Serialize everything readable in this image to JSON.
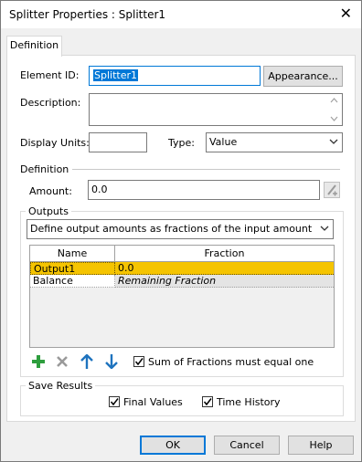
{
  "window": {
    "title": "Splitter Properties : Splitter1"
  },
  "tabs": [
    {
      "label": "Definition"
    }
  ],
  "form": {
    "element_id_label": "Element ID:",
    "element_id_value": "Splitter1",
    "appearance_label": "Appearance...",
    "description_label": "Description:",
    "description_value": "",
    "display_units_label": "Display Units:",
    "display_units_value": "",
    "type_label": "Type:",
    "type_value": "Value"
  },
  "definition": {
    "section_label": "Definition",
    "amount_label": "Amount:",
    "amount_value": "0.0"
  },
  "outputs": {
    "group_label": "Outputs",
    "mode_value": "Define output amounts as fractions of the input amount",
    "columns": {
      "name": "Name",
      "fraction": "Fraction"
    },
    "rows": [
      {
        "name": "Output1",
        "fraction": "0.0"
      },
      {
        "name": "Balance",
        "fraction": "Remaining Fraction"
      }
    ],
    "sum_checkbox_label": "Sum of Fractions must equal one",
    "sum_checked": true
  },
  "save_results": {
    "group_label": "Save Results",
    "final_values_label": "Final Values",
    "final_values_checked": true,
    "time_history_label": "Time History",
    "time_history_checked": true
  },
  "buttons": {
    "ok": "OK",
    "cancel": "Cancel",
    "help": "Help"
  },
  "colors": {
    "accent": "#0078d7",
    "selected_row": "#f5c400",
    "add_icon": "#2e9e3e",
    "arrow_icon": "#1e73be"
  }
}
